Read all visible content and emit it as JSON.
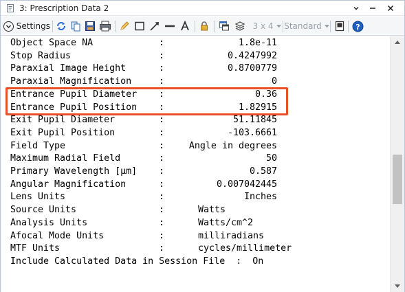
{
  "window": {
    "title": "3: Prescription Data 2"
  },
  "toolbar": {
    "settings_label": "Settings",
    "layout_dropdown": "3 x 4",
    "style_dropdown": "Standard",
    "icons": [
      "refresh-icon",
      "copy-icon",
      "save-icon",
      "print-icon",
      "pencil-icon",
      "rectangle-icon",
      "arrow-icon",
      "line-icon",
      "text-icon",
      "lock-icon",
      "window-icon",
      "layers-icon",
      "layout-dropdown",
      "style-dropdown",
      "single-window-icon",
      "help-icon"
    ]
  },
  "rows": [
    {
      "label": "Object Space NA",
      "colon": ":",
      "value": "1.8e-11",
      "align": "right"
    },
    {
      "label": "Stop Radius",
      "colon": ":",
      "value": "0.4247992",
      "align": "right"
    },
    {
      "label": "Paraxial Image Height",
      "colon": ":",
      "value": "0.8700779",
      "align": "right"
    },
    {
      "label": "Paraxial Magnification",
      "colon": ":",
      "value": "0",
      "align": "right"
    },
    {
      "label": "Entrance Pupil Diameter",
      "colon": ":",
      "value": "0.36",
      "align": "right"
    },
    {
      "label": "Entrance Pupil Position",
      "colon": ":",
      "value": "1.82915",
      "align": "right"
    },
    {
      "label": "Exit Pupil Diameter",
      "colon": ":",
      "value": "51.11845",
      "align": "right"
    },
    {
      "label": "Exit Pupil Position",
      "colon": ":",
      "value": "-103.6661",
      "align": "right"
    },
    {
      "label": "Field Type",
      "colon": ":",
      "value": "Angle in degrees",
      "align": "right"
    },
    {
      "label": "Maximum Radial Field",
      "colon": ":",
      "value": "50",
      "align": "right"
    },
    {
      "label": "Primary Wavelength [µm]",
      "colon": ":",
      "value": "0.587",
      "align": "right"
    },
    {
      "label": "Angular Magnification",
      "colon": ":",
      "value": "0.007042445",
      "align": "right"
    },
    {
      "label": "Lens Units",
      "colon": ":",
      "value": "Inches",
      "align": "right"
    },
    {
      "label": "Source Units",
      "colon": ":",
      "value": "Watts",
      "align": "left"
    },
    {
      "label": "Analysis Units",
      "colon": ":",
      "value": "Watts/cm^2",
      "align": "left"
    },
    {
      "label": "Afocal Mode Units",
      "colon": ":",
      "value": "milliradians",
      "align": "left"
    },
    {
      "label": "MTF Units",
      "colon": ":",
      "value": "cycles/millimeter",
      "align": "left"
    },
    {
      "label": "Include Calculated Data in Session File  :  On",
      "colon": "",
      "value": "",
      "align": "none"
    }
  ],
  "colors": {
    "highlight": "#e8502a",
    "toolbar_bg": "#f5f6f7",
    "help_icon": "#1f5fbf"
  }
}
